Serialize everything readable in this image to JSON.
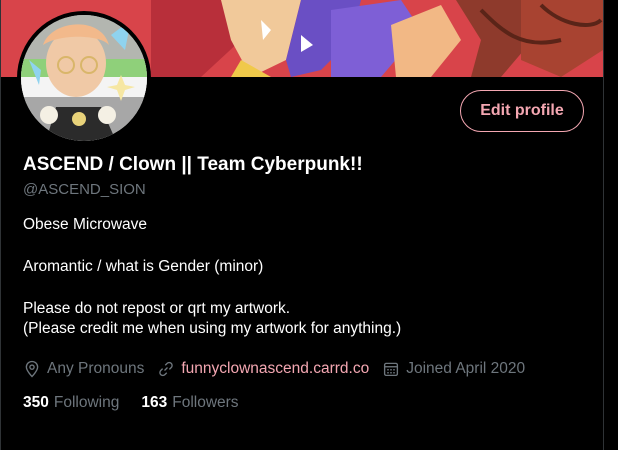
{
  "profile": {
    "display_name": "ASCEND / Clown || Team Cyberpunk!!",
    "handle": "@ASCEND_SION",
    "edit_button_label": "Edit profile",
    "bio_lines": [
      "Obese Microwave",
      "Aromantic / what is Gender (minor)",
      "Please do not repost or qrt my artwork.",
      "(Please credit me when using my artwork for anything.)"
    ],
    "meta": {
      "pronouns": "Any Pronouns",
      "website": "funnyclownascend.carrd.co",
      "joined": "Joined April 2020"
    },
    "stats": {
      "following_count": "350",
      "following_label": "Following",
      "followers_count": "163",
      "followers_label": "Followers"
    }
  },
  "icons": {
    "pronouns": "location-pin-icon",
    "website": "link-icon",
    "joined": "calendar-icon"
  },
  "colors": {
    "background": "#000000",
    "accent": "#f4a7b2",
    "secondary_text": "#6e767d",
    "banner": "#d8454a"
  }
}
